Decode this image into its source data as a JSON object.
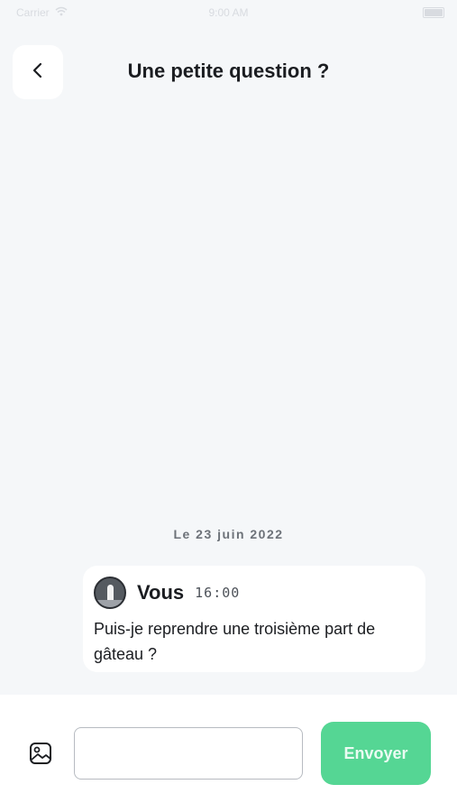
{
  "status_bar": {
    "carrier": "Carrier",
    "time": "9:00 AM"
  },
  "header": {
    "back_icon": "chevron-left-icon",
    "title": "Une petite question ?"
  },
  "conversation": {
    "date_separator": "Le 23 juin 2022",
    "messages": [
      {
        "sender": "Vous",
        "time": "16:00",
        "text": "Puis-je reprendre une troisième part de gâteau ?",
        "avatar_icon": "avatar"
      }
    ]
  },
  "composer": {
    "attach_icon": "image-icon",
    "input_value": "",
    "input_placeholder": "",
    "send_label": "Envoyer"
  },
  "colors": {
    "background": "#f5f7f9",
    "send_button": "#55d694",
    "title_text": "#1b1d21"
  }
}
